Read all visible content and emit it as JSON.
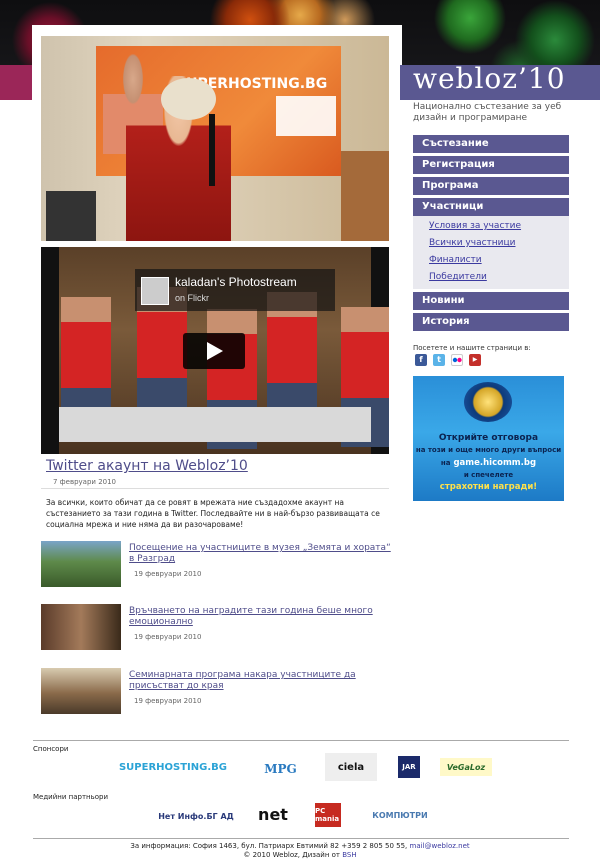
{
  "site": {
    "logo_text": "webloz’10",
    "tagline": "Национално състезание за уеб дизайн и програмиране"
  },
  "nav": {
    "items": [
      "Състезание",
      "Регистрация",
      "Програма",
      "Участници"
    ],
    "sub_items": [
      "Условия за участие",
      "Всички участници",
      "Финалисти",
      "Победители"
    ],
    "bottom_items": [
      "Новини",
      "История"
    ]
  },
  "social": {
    "label": "Посетете и нашите страници в:",
    "icons": [
      "facebook-icon",
      "twitter-icon",
      "flickr-icon",
      "youtube-icon"
    ],
    "colors": {
      "facebook": "#3b5998",
      "twitter": "#5ab3e8",
      "flickr": "#ff0084",
      "youtube": "#c4302b"
    }
  },
  "ad": {
    "line1": "Открийте отговора",
    "line2": "на този и още много други въпроси",
    "line3_prefix": "на",
    "line3_site": "game.hicomm.bg",
    "line4": "и спечелете",
    "line5": "страхотни награди!"
  },
  "photo": {
    "brand": "SUPERHOSTING.BG"
  },
  "video": {
    "title": "kaladan's Photostream",
    "subtitle": "on Flickr"
  },
  "main_post": {
    "title": "Twitter акаунт на Webloz’10",
    "date": "7 февруари 2010",
    "body": "За всички, които обичат да се ровят в мрежата ние създадохме акаунт на състезанието за тази година в Twitter. Последвайте ни в най-бързо развиващата се социална мрежа и ние няма да ви разочароваме!"
  },
  "posts": [
    {
      "title": "Посещение на участниците в музея „Земята и хората“ в Разград",
      "date": "19 февруари 2010"
    },
    {
      "title": "Връчването на наградите тази година беше много емоционално",
      "date": "19 февруари 2010"
    },
    {
      "title": "Семинарната програма накара участниците да присъстват до края",
      "date": "19 февруари 2010"
    }
  ],
  "footer": {
    "sponsors_label": "Спонсори",
    "sponsors": [
      "SUPERHOSTING.BG",
      "MPG",
      "ciela",
      "JAR",
      "VeGaLoz"
    ],
    "media_label": "Медийни партньори",
    "media": [
      "Нет Инфо.БГ АД",
      "net",
      "PC mania",
      "КОМПЮТРИ"
    ],
    "info": "За информация: София 1463, бул. Патриарх Евтимий 82 +359 2 805 50 55,",
    "email": "mail@webloz.net",
    "copyright": "© 2010 Webloz, Дизайн от",
    "designer": "BSH"
  }
}
